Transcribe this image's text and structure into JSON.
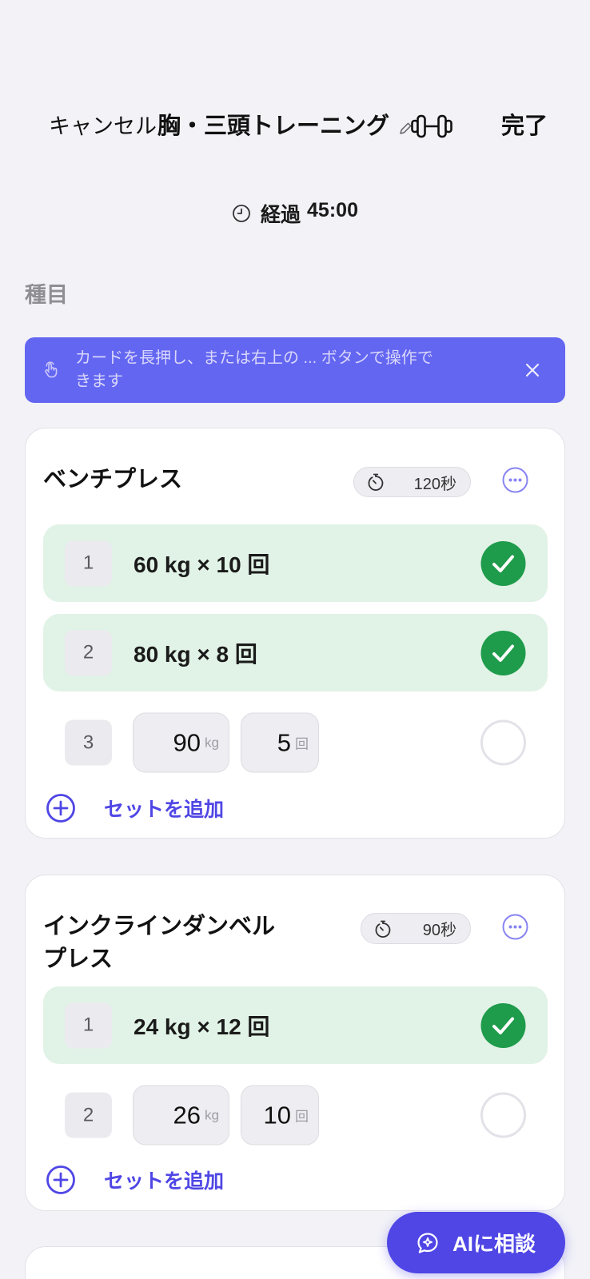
{
  "header": {
    "cancel_label": "キャンセル",
    "title": "胸・三頭トレーニング",
    "done_label": "完了",
    "edit_icon": "pencil-icon",
    "title_icon": "dumbbell-icon"
  },
  "timer": {
    "icon": "clock-icon",
    "label": "経過",
    "elapsed": "45:00"
  },
  "section_label": "種目",
  "hint_banner": {
    "icon": "tap-icon",
    "text": "カードを長押し、または右上の ... ボタンで操作できます",
    "close_icon": "close-icon"
  },
  "exercises": [
    {
      "name": "ベンチプレス",
      "rest_icon": "stopwatch-icon",
      "rest": "120秒",
      "menu_icon": "more-icon",
      "sets": [
        {
          "number": "1",
          "completed": true,
          "summary": "60 kg × 10 回"
        },
        {
          "number": "2",
          "completed": true,
          "summary": "80 kg × 8 回"
        },
        {
          "number": "3",
          "completed": false,
          "weight": "90",
          "weight_unit": "kg",
          "reps": "5",
          "reps_unit": "回"
        }
      ],
      "add_set_icon": "plus-circle-icon",
      "add_set_label": "セットを追加"
    },
    {
      "name": "インクラインダンベルプレス",
      "rest_icon": "stopwatch-icon",
      "rest": "90秒",
      "menu_icon": "more-icon",
      "sets": [
        {
          "number": "1",
          "completed": true,
          "summary": "24 kg × 12 回"
        },
        {
          "number": "2",
          "completed": false,
          "weight": "26",
          "weight_unit": "kg",
          "reps": "10",
          "reps_unit": "回"
        }
      ],
      "add_set_icon": "plus-circle-icon",
      "add_set_label": "セットを追加"
    }
  ],
  "ai_button": {
    "icon": "ai-chat-icon",
    "label": "AIに相談"
  },
  "colors": {
    "background": "#F2F2F7",
    "banner": "#6366F1",
    "accent": "#4F46E5",
    "success": "#1E9B4B",
    "completed_row": "#E1F2E6"
  }
}
